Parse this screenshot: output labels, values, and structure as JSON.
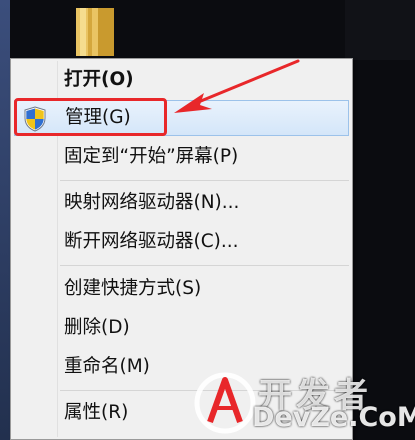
{
  "context_menu": {
    "items": [
      {
        "label": "打开(O)"
      },
      {
        "label": "管理(G)"
      },
      {
        "label": "固定到“开始”屏幕(P)"
      },
      {
        "label": "映射网络驱动器(N)..."
      },
      {
        "label": "断开网络驱动器(C)..."
      },
      {
        "label": "创建快捷方式(S)"
      },
      {
        "label": "删除(D)"
      },
      {
        "label": "重命名(M)"
      },
      {
        "label": "属性(R)"
      }
    ],
    "highlighted_item": "管理(G)"
  },
  "icons": {
    "manage": "uac-shield-icon",
    "desktop": "folder-icon"
  },
  "annotation": {
    "color": "#e8272a"
  },
  "watermark": {
    "line1": "开发者",
    "line2": "DevZe.CoM"
  }
}
